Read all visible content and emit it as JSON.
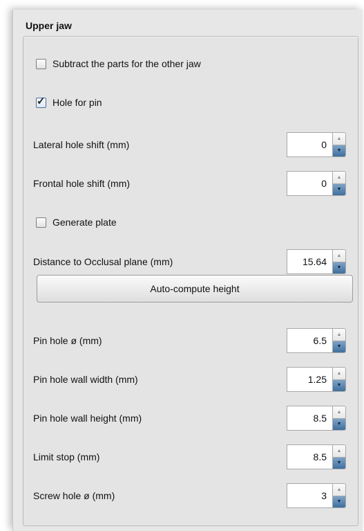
{
  "group": {
    "title": "Upper jaw"
  },
  "checkboxes": {
    "subtract": {
      "label": "Subtract the parts for the other jaw",
      "checked": false
    },
    "hole_for_pin": {
      "label": "Hole for pin",
      "checked": true
    },
    "generate_plate": {
      "label": "Generate plate",
      "checked": false
    }
  },
  "fields": {
    "lateral_shift": {
      "label": "Lateral hole shift (mm)",
      "value": "0"
    },
    "frontal_shift": {
      "label": "Frontal hole shift (mm)",
      "value": "0"
    },
    "distance_occlusal": {
      "label": "Distance to Occlusal plane (mm)",
      "value": "15.64"
    },
    "pin_hole_diameter": {
      "label": "Pin hole ø (mm)",
      "value": "6.5"
    },
    "pin_wall_width": {
      "label": "Pin hole wall width (mm)",
      "value": "1.25"
    },
    "pin_wall_height": {
      "label": "Pin hole wall height (mm)",
      "value": "8.5"
    },
    "limit_stop": {
      "label": "Limit stop (mm)",
      "value": "8.5"
    },
    "screw_hole_diameter": {
      "label": "Screw hole ø (mm)",
      "value": "3"
    }
  },
  "buttons": {
    "auto_compute": "Auto-compute height"
  },
  "icons": {
    "checkmark": "✓",
    "spin_up": "▲",
    "spin_down": "▼"
  }
}
